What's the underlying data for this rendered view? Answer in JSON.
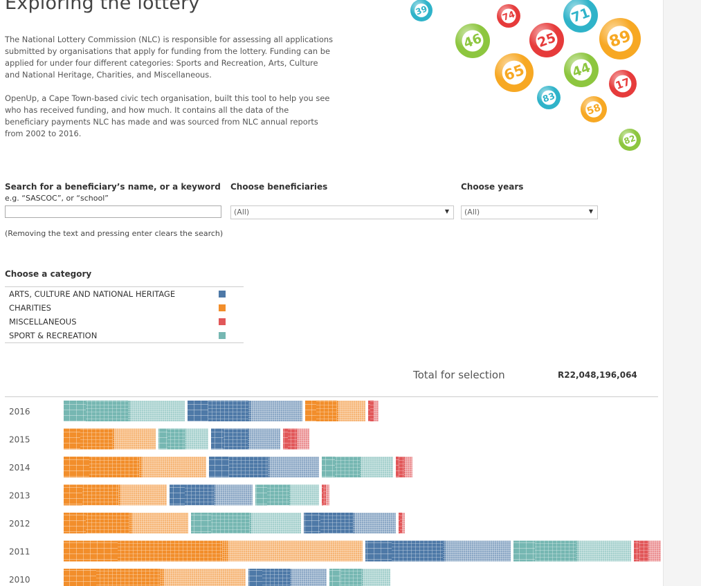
{
  "title": "Exploring the lottery",
  "intro": [
    "The National Lottery Commission (NLC) is responsible for assessing all applications submitted by organisations that apply for funding from the lottery. Funding can be applied for under four different categories: Sports and Recreation, Arts, Culture and National Heritage, Charities, and Miscellaneous.",
    "OpenUp, a Cape Town-based civic tech organisation, built this tool to help you see who has received funding, and how much. It contains all the data of the beneficiary payments NLC has made and was sourced from NLC annual reports from 2002 to 2016."
  ],
  "balls": [
    "39",
    "74",
    "71",
    "46",
    "25",
    "89",
    "65",
    "44",
    "17",
    "83",
    "58",
    "82"
  ],
  "filters": {
    "search_label": "Search for a beneficiary’s name, or a keyword",
    "search_hint": "e.g. “SASCOC”, or “school”",
    "search_value": "",
    "beneficiaries_label": "Choose beneficiaries",
    "beneficiaries_value": "(All)",
    "years_label": "Choose years",
    "years_value": "(All)",
    "note": "(Removing the text and pressing enter clears the search)"
  },
  "categories": {
    "label": "Choose a category",
    "items": [
      {
        "name": "ARTS, CULTURE AND NATIONAL HERITAGE",
        "color": "#4e79a7"
      },
      {
        "name": "CHARITIES",
        "color": "#f28e2b"
      },
      {
        "name": "MISCELLANEOUS",
        "color": "#e15759"
      },
      {
        "name": "SPORT & RECREATION",
        "color": "#76b7b2"
      }
    ]
  },
  "total": {
    "label": "Total for selection",
    "value": "R22,048,196,064"
  },
  "chart_data": {
    "type": "bar",
    "categories": [
      "2016",
      "2015",
      "2014",
      "2013",
      "2012",
      "2011",
      "2010"
    ],
    "series": [
      {
        "name": "SPORT & RECREATION",
        "values": [
          175,
          72,
          103,
          92,
          159,
          170,
          88
        ]
      },
      {
        "name": "ARTS, CULTURE AND NATIONAL HERITAGE",
        "values": [
          166,
          100,
          159,
          120,
          133,
          210,
          113
        ]
      },
      {
        "name": "CHARITIES",
        "values": [
          87,
          133,
          206,
          149,
          180,
          432,
          263
        ]
      },
      {
        "name": "MISCELLANEOUS",
        "values": [
          15,
          38,
          24,
          11,
          9,
          39,
          0
        ]
      }
    ],
    "order": [
      [
        "SPORT & RECREATION",
        "ARTS, CULTURE AND NATIONAL HERITAGE",
        "CHARITIES",
        "MISCELLANEOUS"
      ],
      [
        "CHARITIES",
        "SPORT & RECREATION",
        "ARTS, CULTURE AND NATIONAL HERITAGE",
        "MISCELLANEOUS"
      ],
      [
        "CHARITIES",
        "ARTS, CULTURE AND NATIONAL HERITAGE",
        "SPORT & RECREATION",
        "MISCELLANEOUS"
      ],
      [
        "CHARITIES",
        "ARTS, CULTURE AND NATIONAL HERITAGE",
        "SPORT & RECREATION",
        "MISCELLANEOUS"
      ],
      [
        "CHARITIES",
        "SPORT & RECREATION",
        "ARTS, CULTURE AND NATIONAL HERITAGE",
        "MISCELLANEOUS"
      ],
      [
        "CHARITIES",
        "ARTS, CULTURE AND NATIONAL HERITAGE",
        "SPORT & RECREATION",
        "MISCELLANEOUS"
      ],
      [
        "CHARITIES",
        "ARTS, CULTURE AND NATIONAL HERITAGE",
        "SPORT & RECREATION",
        "MISCELLANEOUS"
      ]
    ]
  }
}
